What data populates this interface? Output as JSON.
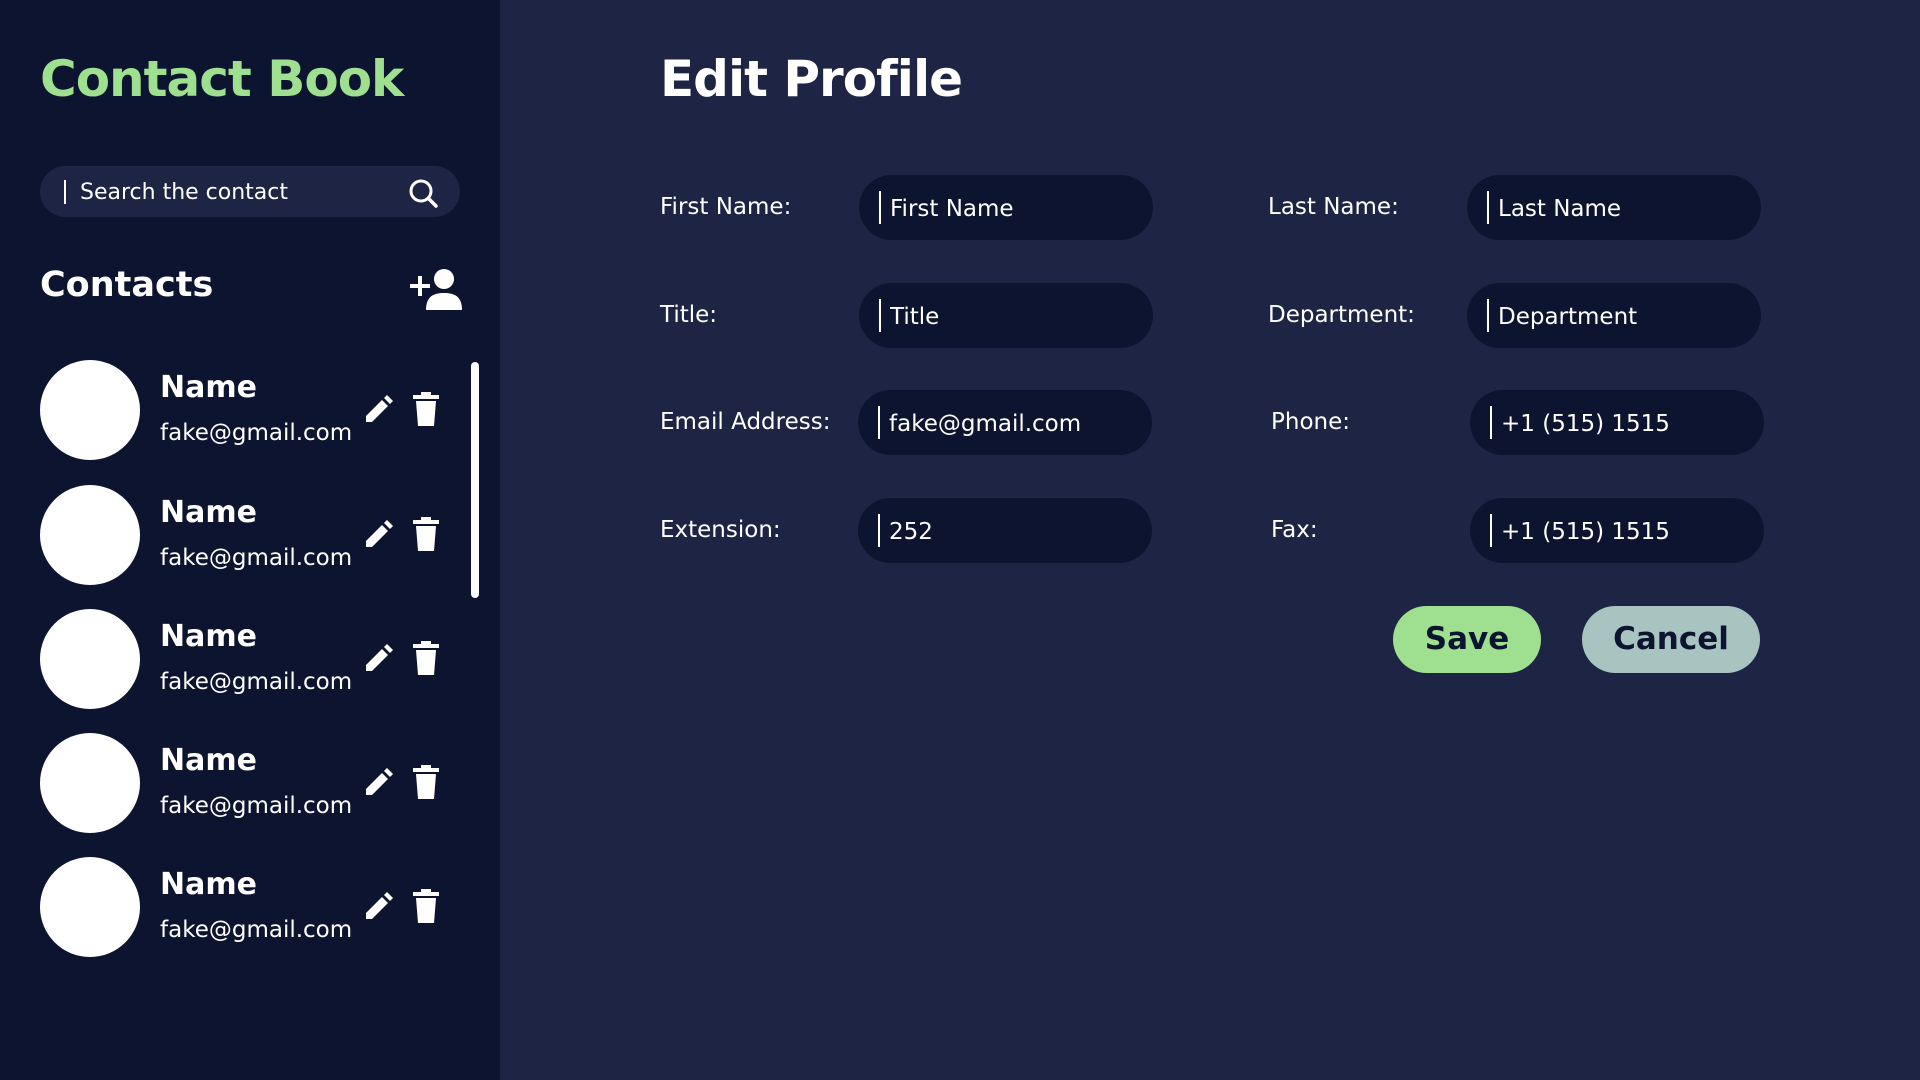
{
  "sidebar": {
    "app_title": "Contact Book",
    "search": {
      "placeholder": "Search the contact",
      "icon": "search-icon"
    },
    "contacts_heading": "Contacts",
    "add_icon": "add-person-icon",
    "contacts": [
      {
        "name": "Name",
        "email": "fake@gmail.com"
      },
      {
        "name": "Name",
        "email": "fake@gmail.com"
      },
      {
        "name": "Name",
        "email": "fake@gmail.com"
      },
      {
        "name": "Name",
        "email": "fake@gmail.com"
      },
      {
        "name": "Name",
        "email": "fake@gmail.com"
      }
    ]
  },
  "main": {
    "title": "Edit Profile",
    "fields": {
      "first_name": {
        "label": "First Name:",
        "placeholder": "First Name",
        "value": ""
      },
      "last_name": {
        "label": "Last Name:",
        "placeholder": "Last Name",
        "value": ""
      },
      "title": {
        "label": "Title:",
        "placeholder": "Title",
        "value": ""
      },
      "department": {
        "label": "Department:",
        "placeholder": "Department",
        "value": ""
      },
      "email": {
        "label": "Email Address:",
        "placeholder": "",
        "value": "fake@gmail.com"
      },
      "phone": {
        "label": "Phone:",
        "placeholder": "",
        "value": "+1 (515) 1515"
      },
      "extension": {
        "label": "Extension:",
        "placeholder": "",
        "value": "252"
      },
      "fax": {
        "label": "Fax:",
        "placeholder": "",
        "value": "+1 (515) 1515"
      }
    },
    "buttons": {
      "save": "Save",
      "cancel": "Cancel"
    }
  },
  "colors": {
    "background": "#1e2544",
    "sidebar": "#0d1430",
    "accent_green": "#9ee08f",
    "cancel": "#a7c4c0",
    "text": "#ffffff"
  }
}
